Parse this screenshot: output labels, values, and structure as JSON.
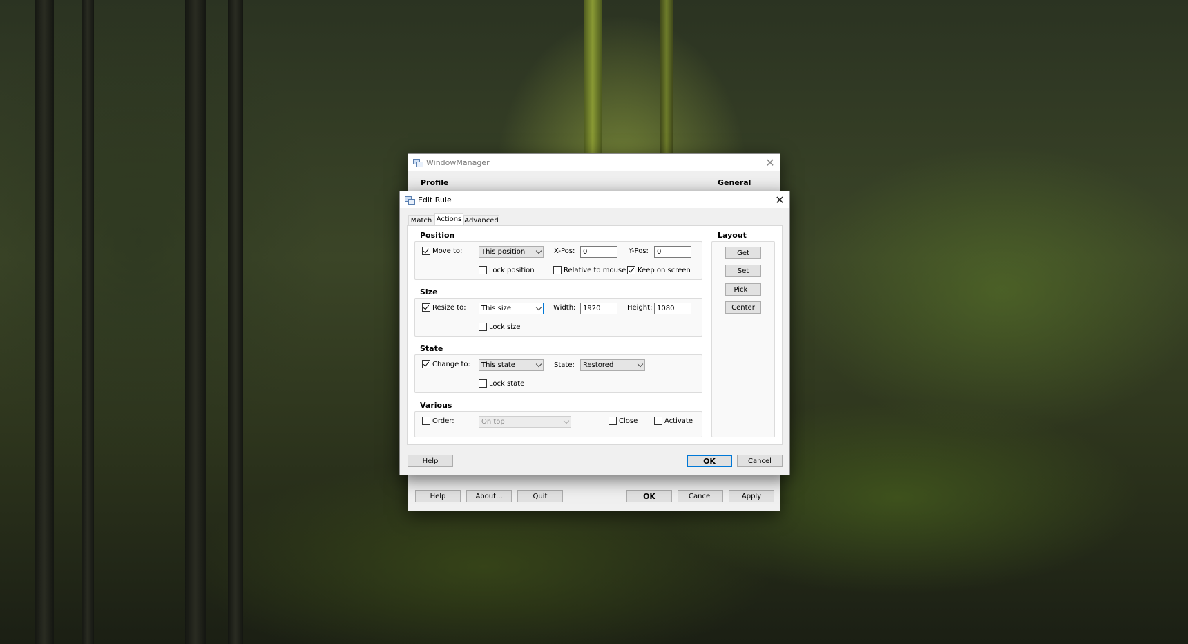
{
  "main_window": {
    "title": "WindowManager",
    "profile_label": "Profile",
    "general_label": "General",
    "buttons": {
      "help": "Help",
      "about": "About...",
      "quit": "Quit",
      "ok": "OK",
      "cancel": "Cancel",
      "apply": "Apply"
    }
  },
  "edit_rule": {
    "title": "Edit Rule",
    "tabs": [
      "Match",
      "Actions",
      "Advanced"
    ],
    "active_tab": "Actions",
    "position": {
      "label": "Position",
      "move_to": {
        "label": "Move to:",
        "checked": true
      },
      "mode": "This position",
      "xpos_label": "X-Pos:",
      "xpos": "0",
      "ypos_label": "Y-Pos:",
      "ypos": "0",
      "lock_position": {
        "label": "Lock position",
        "checked": false
      },
      "relative_to_mouse": {
        "label": "Relative to mouse",
        "checked": false
      },
      "keep_on_screen": {
        "label": "Keep on screen",
        "checked": true
      }
    },
    "size": {
      "label": "Size",
      "resize_to": {
        "label": "Resize to:",
        "checked": true
      },
      "mode": "This size",
      "width_label": "Width:",
      "width": "1920",
      "height_label": "Height:",
      "height": "1080",
      "lock_size": {
        "label": "Lock size",
        "checked": false
      }
    },
    "state": {
      "label": "State",
      "change_to": {
        "label": "Change to:",
        "checked": true
      },
      "mode": "This state",
      "state_label": "State:",
      "state": "Restored",
      "lock_state": {
        "label": "Lock state",
        "checked": false
      }
    },
    "various": {
      "label": "Various",
      "order": {
        "label": "Order:",
        "checked": false
      },
      "order_value": "On top",
      "close": {
        "label": "Close",
        "checked": false
      },
      "activate": {
        "label": "Activate",
        "checked": false
      }
    },
    "layout": {
      "label": "Layout",
      "buttons": {
        "get": "Get",
        "set": "Set",
        "pick": "Pick !",
        "center": "Center"
      }
    },
    "buttons": {
      "help": "Help",
      "ok": "OK",
      "cancel": "Cancel"
    }
  }
}
